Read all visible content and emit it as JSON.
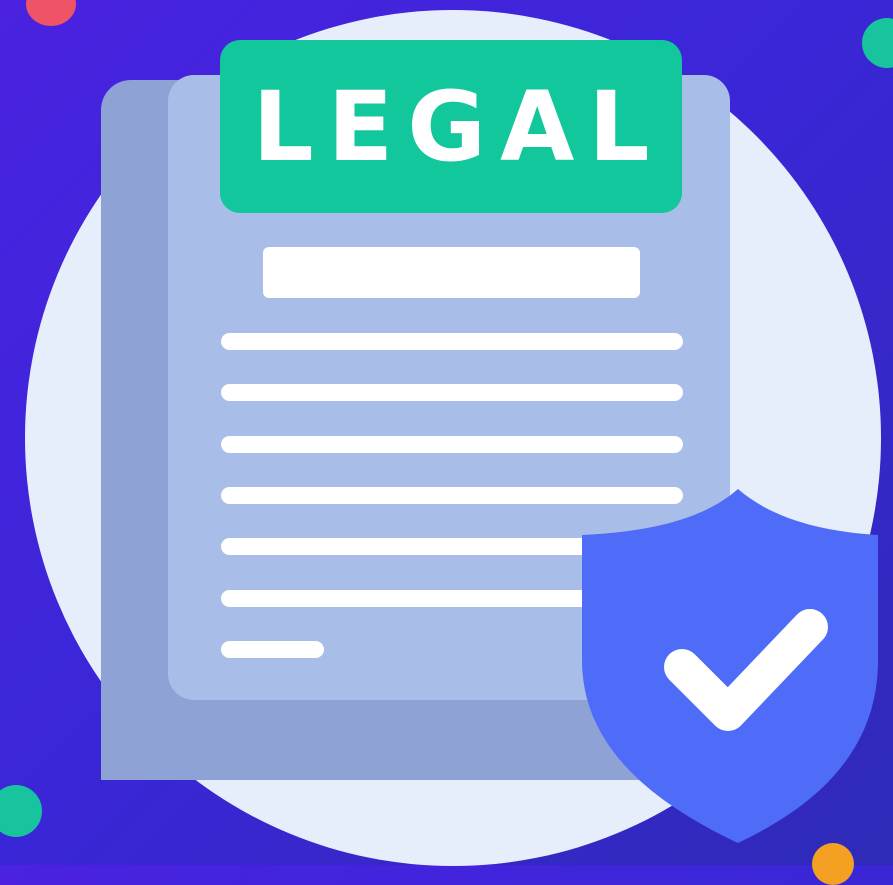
{
  "document": {
    "label": "LEGAL"
  },
  "colors": {
    "background": "#4a22e0",
    "circle": "#e6edfb",
    "document_back": "#8ea2d6",
    "document_front": "#a9bde9",
    "legal_tab": "#12c79b",
    "shield": "#4f6cf9",
    "checkmark": "#ffffff",
    "dot_red": "#ef5466",
    "dot_teal": "#17c49e",
    "dot_orange": "#f4a123"
  },
  "icons": [
    "legal-document-icon",
    "shield-check-icon",
    "checkmark-icon"
  ]
}
